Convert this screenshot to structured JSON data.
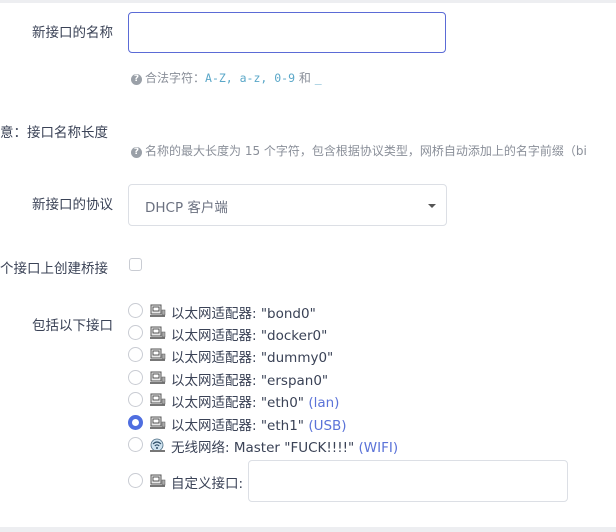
{
  "fields": {
    "name_label": "新接口的名称",
    "name_value": "",
    "name_hint_prefix": "合法字符：",
    "name_hint_chars": "A-Z, a-z, 0-9",
    "name_hint_and": "和",
    "name_hint_underscore": "_",
    "notice_label": "意：接口名称长度",
    "notice_hint": "名称的最大长度为 15 个字符，包含根据协议类型，网桥自动添加上的名字前缀（bi",
    "protocol_label": "新接口的协议",
    "protocol_value": "DHCP 客户端",
    "bridge_label": "个接口上创建桥接",
    "include_label": "包括以下接口"
  },
  "interfaces": [
    {
      "text": "以太网适配器: \"bond0\"",
      "suffix": "",
      "icon": "ethernet-port-icon",
      "selected": false
    },
    {
      "text": "以太网适配器: \"docker0\"",
      "suffix": "",
      "icon": "ethernet-port-icon",
      "selected": false
    },
    {
      "text": "以太网适配器: \"dummy0\"",
      "suffix": "",
      "icon": "ethernet-port-icon",
      "selected": false
    },
    {
      "text": "以太网适配器: \"erspan0\"",
      "suffix": "",
      "icon": "ethernet-port-icon",
      "selected": false
    },
    {
      "text": "以太网适配器: \"eth0\"",
      "suffix": "(lan)",
      "icon": "ethernet-port-icon",
      "selected": false
    },
    {
      "text": "以太网适配器: \"eth1\"",
      "suffix": "(USB)",
      "icon": "ethernet-port-icon",
      "selected": true
    },
    {
      "text": "无线网络: Master \"FUCK!!!!\"",
      "suffix": "(WIFI)",
      "icon": "wifi-icon",
      "selected": false
    }
  ],
  "custom": {
    "label": "自定义接口:",
    "value": ""
  },
  "colors": {
    "accent": "#5b6bd6",
    "radio_selected": "#4f6ee0",
    "link": "#5b73d8",
    "hint_code": "#5aa7c8"
  }
}
